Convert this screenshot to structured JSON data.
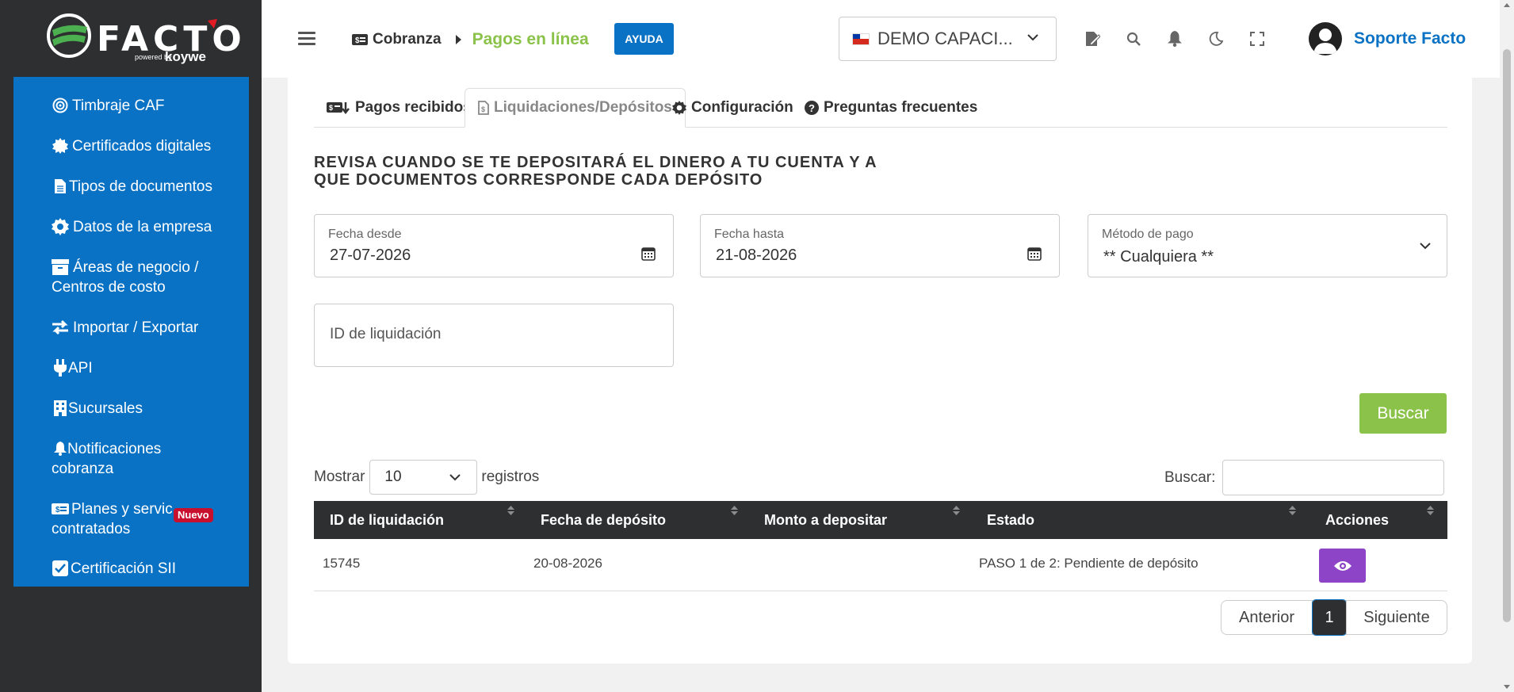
{
  "brand": {
    "name": "FACTO",
    "powered": "powered by",
    "partner": "koywe",
    "logo_colors": [
      "#4caf50",
      "#ffffff",
      "#e31b23"
    ]
  },
  "sidebar": {
    "items": [
      {
        "label": "Timbraje CAF",
        "icon": "target-icon"
      },
      {
        "label": "Certificados digitales",
        "icon": "certificate-icon"
      },
      {
        "label": "Tipos de documentos",
        "icon": "file-icon"
      },
      {
        "label": "Datos de la empresa",
        "icon": "gear-icon"
      },
      {
        "label": "Áreas de negocio /",
        "label2": "Centros de costo",
        "icon": "archive-icon"
      },
      {
        "label": "Importar / Exportar",
        "icon": "exchange-icon"
      },
      {
        "label": "API",
        "icon": "plug-icon"
      },
      {
        "label": "Sucursales",
        "icon": "building-icon"
      },
      {
        "label": "Notificaciones",
        "label2": "cobranza",
        "icon": "bell-icon"
      },
      {
        "label": "Planes y servic",
        "label2": "contratados",
        "icon": "money-icon",
        "badge": "Nuevo"
      },
      {
        "label": "Certificación SII",
        "icon": "check-square-icon"
      }
    ]
  },
  "header": {
    "breadcrumb_root": "Cobranza",
    "breadcrumb_current": "Pagos en línea",
    "help_label": "AYUDA",
    "company": "DEMO CAPACI...",
    "user": "Soporte Facto"
  },
  "tabs": [
    {
      "label": "Pagos recibidos",
      "icon": "money-transfer-icon",
      "active": false
    },
    {
      "label": "Liquidaciones/Depósitos",
      "icon": "file-dollar-icon",
      "active": true
    },
    {
      "label": "Configuración",
      "icon": "gear-icon",
      "active": false
    },
    {
      "label": "Preguntas frecuentes",
      "icon": "question-circle-icon",
      "active": false
    }
  ],
  "heading_line1": "REVISA CUANDO SE TE DEPOSITARÁ EL DINERO A TU CUENTA Y A",
  "heading_line2": "QUE DOCUMENTOS CORRESPONDE CADA DEPÓSITO",
  "filters": {
    "from_label": "Fecha desde",
    "from_value": "27-07-2026",
    "to_label": "Fecha hasta",
    "to_value": "21-08-2026",
    "method_label": "Método de pago",
    "method_value": "** Cualquiera **",
    "id_placeholder": "ID de liquidación",
    "search_button": "Buscar"
  },
  "table_controls": {
    "show_label": "Mostrar",
    "show_value": "10",
    "records_label": "registros",
    "search_label": "Buscar:"
  },
  "table": {
    "columns": [
      "ID de liquidación",
      "Fecha de depósito",
      "Monto a depositar",
      "Estado",
      "Acciones"
    ],
    "rows": [
      {
        "id": "15745",
        "date": "20-08-2026",
        "amount": "",
        "status": "PASO 1 de 2: Pendiente de depósito"
      }
    ]
  },
  "pagination": {
    "prev": "Anterior",
    "current": "1",
    "next": "Siguiente"
  },
  "colors": {
    "sidebar_bg": "#2d2f30",
    "nav_bg": "#0a72c4",
    "accent_green": "#8bc34a",
    "action_purple": "#8e44c6",
    "table_header": "#2d2f30"
  }
}
